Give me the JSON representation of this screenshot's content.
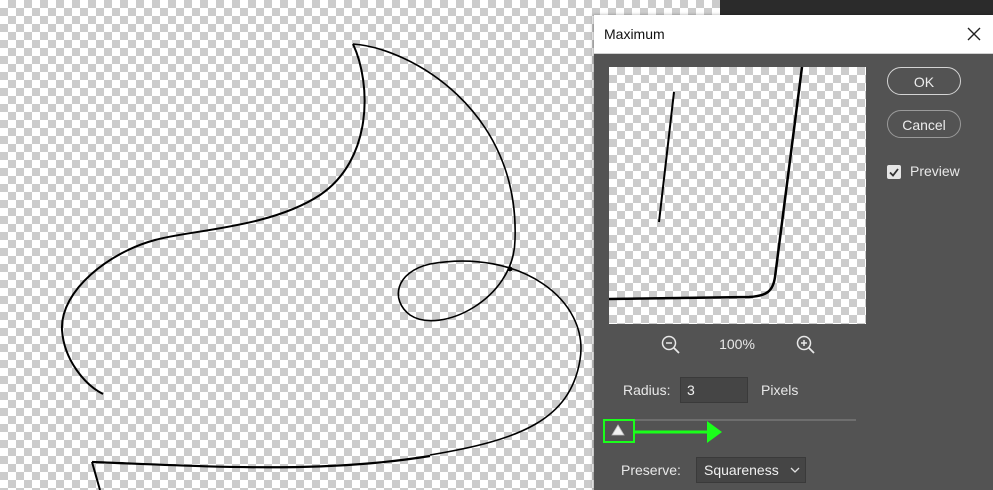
{
  "dialog": {
    "title": "Maximum",
    "ok_label": "OK",
    "cancel_label": "Cancel",
    "preview_label": "Preview",
    "preview_checked": true,
    "zoom_level": "100%",
    "radius_label": "Radius:",
    "radius_value": "3",
    "radius_units": "Pixels",
    "preserve_label": "Preserve:",
    "preserve_value": "Squareness"
  },
  "colors": {
    "dialog_bg": "#535353",
    "highlight": "#1aff1a",
    "canvas_dark_strip": "#2b2b2b"
  },
  "icons": [
    "close-icon",
    "zoom-out-icon",
    "zoom-in-icon",
    "checkmark-icon",
    "chevron-down-icon",
    "slider-handle-icon",
    "arrow-right-icon"
  ]
}
